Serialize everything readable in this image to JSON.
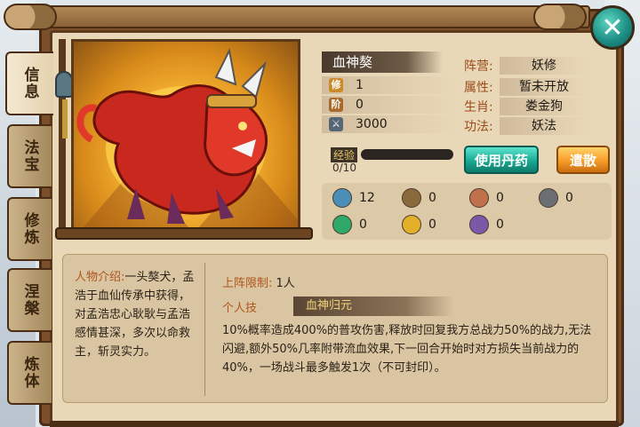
{
  "tabs": [
    {
      "label": "信息",
      "active": true
    },
    {
      "label": "法宝",
      "active": false
    },
    {
      "label": "修炼",
      "active": false
    },
    {
      "label": "涅槃",
      "active": false
    },
    {
      "label": "炼体",
      "active": false
    }
  ],
  "close_icon": "close-x-icon",
  "pet": {
    "name": "血神獒",
    "stats": [
      {
        "icon": "cultivation-icon",
        "icon_text": "修",
        "value": "1"
      },
      {
        "icon": "level-icon",
        "icon_text": "阶",
        "value": "0"
      },
      {
        "icon": "swords-icon",
        "icon_text": "",
        "value": "3000"
      }
    ],
    "attributes": [
      {
        "label": "阵营:",
        "value": "妖修"
      },
      {
        "label": "属性:",
        "value": "暂未开放"
      },
      {
        "label": "生肖:",
        "value": "娄金狗"
      },
      {
        "label": "功法:",
        "value": "妖法"
      }
    ],
    "exp_label": "经验",
    "exp_value": "0/10",
    "exp_fraction": 0
  },
  "buttons": {
    "use_pill": "使用丹药",
    "dismiss": "遣散"
  },
  "equipment": [
    {
      "icon": "armor-figure-icon",
      "value": "12",
      "color": "#4b8fb8"
    },
    {
      "icon": "shield-mask-icon",
      "value": "0",
      "color": "#8a6a3a"
    },
    {
      "icon": "beast-face-icon",
      "value": "0",
      "color": "#c0704a"
    },
    {
      "icon": "helmet-icon",
      "value": "0",
      "color": "#6b6f73"
    },
    {
      "icon": "green-orb-icon",
      "value": "0",
      "color": "#2fa86a"
    },
    {
      "icon": "gold-badge-icon",
      "value": "0",
      "color": "#e3b02a"
    },
    {
      "icon": "purple-figure-icon",
      "value": "0",
      "color": "#7a5aa8"
    }
  ],
  "description": {
    "intro_label": "人物介绍:",
    "intro_text": "一头獒犬，孟浩于血仙传承中获得，对孟浩忠心耿耿与孟浩感情甚深，多次以命救主，斩灵实力。",
    "limit_label": "上阵限制:",
    "limit_value": "1人",
    "skill_label": "个人技",
    "skill_name": "血神归元",
    "skill_desc": "10%概率造成400%的普攻伤害,释放时回复我方总战力50%的战力,无法闪避,额外50%几率附带流血效果,下一回合开始时对方损失当前战力的40%，一场战斗最多触发1次（不可封印）。"
  }
}
